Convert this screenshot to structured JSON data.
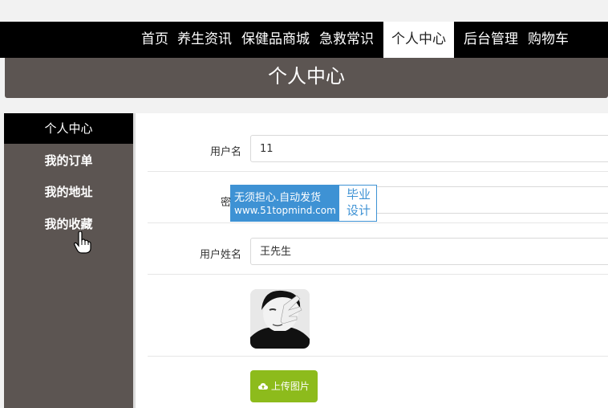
{
  "nav": {
    "items": [
      {
        "label": "首页"
      },
      {
        "label": "养生资讯"
      },
      {
        "label": "保健品商城"
      },
      {
        "label": "急救常识"
      },
      {
        "label": "个人中心"
      },
      {
        "label": "后台管理"
      },
      {
        "label": "购物车"
      }
    ],
    "active": "个人中心"
  },
  "banner": {
    "title": "个人中心"
  },
  "sidebar": {
    "items": [
      {
        "label": "个人中心"
      },
      {
        "label": "我的订单"
      },
      {
        "label": "我的地址"
      },
      {
        "label": "我的收藏"
      }
    ]
  },
  "form": {
    "username_label": "用户名",
    "username_value": "11",
    "password_label": "密码",
    "realname_label": "用户姓名",
    "realname_value": "王先生",
    "upload_label": "上传图片"
  },
  "watermark": {
    "line1": "无须担心.自动发货",
    "line2": "www.51topmind.com",
    "right1": "毕业",
    "right2": "设计"
  },
  "colors": {
    "accent": "#8dbb1c",
    "sidebar": "#5c5552",
    "watermark": "#3e92d4"
  }
}
